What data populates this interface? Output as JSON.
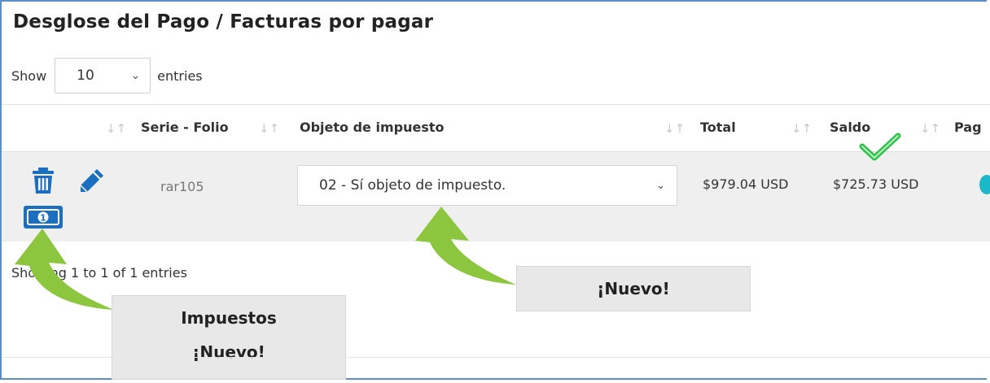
{
  "title": "Desglose del Pago / Facturas por pagar",
  "length": {
    "prefix": "Show",
    "value": "10",
    "suffix": "entries"
  },
  "columns": [
    "Serie - Folio",
    "Objeto de impuesto",
    "Total",
    "Saldo",
    "Pag"
  ],
  "row": {
    "folio": "rar105",
    "objeto": "02 - Sí objeto de impuesto.",
    "total": "$979.04 USD",
    "saldo": "$725.73 USD"
  },
  "info": "Showing 1 to 1 of 1 entries",
  "callouts": {
    "nuevo_top": "¡Nuevo!",
    "impuestos": "Impuestos",
    "nuevo_bottom": "¡Nuevo!"
  },
  "colors": {
    "accent": "#1a6fc0",
    "arrow": "#8cc63f",
    "check": "#2ec14a",
    "teal": "#1cb8c8"
  },
  "icons": [
    "trash-icon",
    "pencil-icon",
    "money-icon",
    "sort-icon",
    "chevron-down-icon",
    "checkmark-icon",
    "curved-arrow-icon"
  ]
}
